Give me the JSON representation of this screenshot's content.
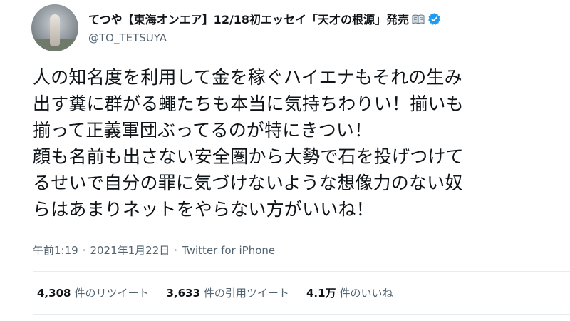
{
  "author": {
    "display_name": "てつや【東海オンエア】12/18初エッセイ「天才の根源」発売",
    "handle": "@TO_TETSUYA",
    "avatar_icon": "avatar",
    "badge_icons": [
      "open-book-icon",
      "verified-badge-icon"
    ],
    "verified_color": "#1d9bf0"
  },
  "tweet": {
    "text": "人の知名度を利用して金を稼ぐハイエナもそれの生み\n出す糞に群がる蠅たちも本当に気持ちわりい！揃いも\n揃って正義軍団ぶってるのが特にきつい！\n顔も名前も出さない安全圏から大勢で石を投げつけて\nるせいで自分の罪に気づけないような想像力のない奴\nらはあまりネットをやらない方がいいね！"
  },
  "meta": {
    "time": "午前1:19",
    "separator": "·",
    "date": "2021年1月22日",
    "source": "Twitter for iPhone"
  },
  "stats": {
    "retweets": {
      "count": "4,308",
      "label": "件のリツイート"
    },
    "quotes": {
      "count": "3,633",
      "label": "件の引用ツイート"
    },
    "likes": {
      "count": "4.1万",
      "label": "件のいいね"
    }
  }
}
